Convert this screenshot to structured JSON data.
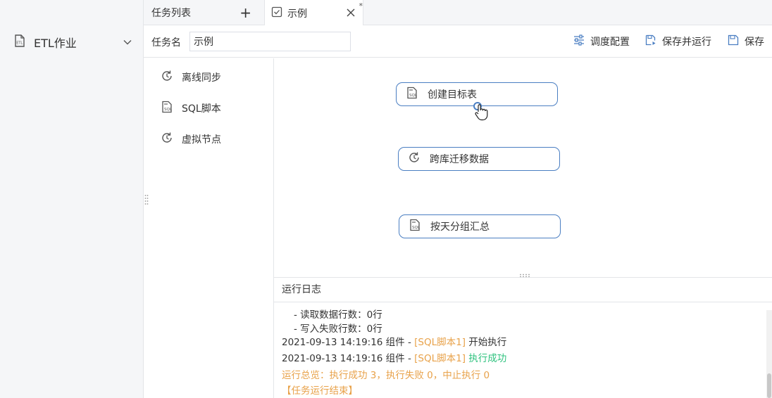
{
  "app_sidebar": {
    "item_label": "ETL作业"
  },
  "tabs": {
    "list_label": "任务列表",
    "active_label": "示例",
    "dirty_marker": "*"
  },
  "toolbar": {
    "name_label": "任务名",
    "name_value": "示例",
    "schedule_label": "调度配置",
    "save_run_label": "保存并运行",
    "save_label": "保存"
  },
  "palette": {
    "items": [
      {
        "label": "离线同步",
        "icon": "sync-icon"
      },
      {
        "label": "SQL脚本",
        "icon": "sql-icon"
      },
      {
        "label": "虚拟节点",
        "icon": "sync-icon"
      }
    ]
  },
  "canvas": {
    "nodes": [
      {
        "label": "创建目标表",
        "icon": "sql-icon"
      },
      {
        "label": "跨库迁移数据",
        "icon": "sync-icon"
      },
      {
        "label": "按天分组汇总",
        "icon": "sql-icon"
      }
    ]
  },
  "log": {
    "title": "运行日志",
    "lines": [
      {
        "text": "- 读取数据行数：0行"
      },
      {
        "text": "- 写入失败行数：0行"
      },
      {
        "prefix": "2021-09-13 14:19:16 组件 - ",
        "component": "[SQL脚本1]",
        "status": " 开始执行"
      },
      {
        "prefix": "2021-09-13 14:19:16 组件 - ",
        "component": "[SQL脚本1]",
        "status": " 执行成功"
      },
      {
        "text": "运行总览：执行成功 3，执行失败 0，中止执行 0"
      },
      {
        "text": "【任务运行结束】"
      }
    ]
  },
  "colors": {
    "accent": "#4a7ec2",
    "warning": "#e8a24a",
    "success": "#2ec27e"
  }
}
